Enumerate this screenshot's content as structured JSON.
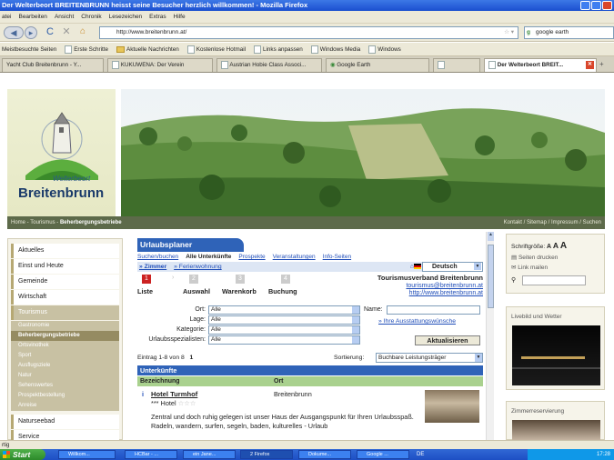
{
  "window": {
    "title": "Der Welterbeort BREITENBRUNN heisst seine Besucher herzlich willkommen! - Mozilla Firefox"
  },
  "menu": [
    "atei",
    "Bearbeiten",
    "Ansicht",
    "Chronik",
    "Lesezeichen",
    "Extras",
    "Hilfe"
  ],
  "nav": {
    "url": "http://www.breitenbrunn.at/",
    "search_value": "google earth"
  },
  "bookmarks": [
    "Meistbesuchte Seiten",
    "Erste Schritte",
    "Aktuelle Nachrichten",
    "Kostenlose Hotmail",
    "Links anpassen",
    "Windows Media",
    "Windows"
  ],
  "tabs": [
    "Yacht Club Breitenbrunn - Y...",
    "KUKUWENA: Der Verein",
    "Austrian Hobie Class Associ...",
    "Google Earth",
    "",
    "Der Welterbeort BREIT..."
  ],
  "site": {
    "logo_small": "Welterbeort",
    "logo_big": "Breitenbrunn",
    "breadcrumb": {
      "home": "Home",
      "sep": " - ",
      "tourismus": "Tourismus",
      "current": "Beherbergungsbetriebe"
    },
    "breadcrumb_right": "Kontakt / Sitemap / Impressum / Suchen"
  },
  "leftnav": {
    "items": [
      "Aktuelles",
      "Einst und Heute",
      "Gemeinde",
      "Wirtschaft"
    ],
    "section": "Tourismus",
    "subitems": [
      "Gastronomie",
      "Beherbergungsbetriebe",
      "Ortsvinothek",
      "Sport",
      "Ausflugsziele",
      "Natur",
      "Sehenswertes",
      "Prospektbestellung",
      "Anreise"
    ],
    "bottom": [
      "Naturseebad",
      "Service"
    ]
  },
  "planer": {
    "title": "Urlaubsplaner",
    "tabs": [
      "Suchen/buchen",
      "Alle Unterkünfte",
      "Prospekte",
      "Veranstaltungen",
      "Info-Seiten"
    ],
    "sub_active": "» Zimmer",
    "sub_other": "» Ferienwohnung",
    "language": "Deutsch",
    "steps": [
      {
        "n": "1",
        "label": "Liste"
      },
      {
        "n": "2",
        "label": "Auswahl"
      },
      {
        "n": "3",
        "label": "Warenkorb"
      },
      {
        "n": "4",
        "label": "Buchung"
      }
    ],
    "org_name": "Tourismusverband Breitenbrunn",
    "org_email": "tourismus@breitenbrunn.at",
    "org_web": "http://www.breitenbrunn.at",
    "form": {
      "ort_label": "Ort:",
      "ort_value": "Alle",
      "lage_label": "Lage:",
      "lage_value": "Alle",
      "kategorie_label": "Kategorie:",
      "kategorie_value": "Alle",
      "spez_label": "Urlaubsspezialisten:",
      "spez_value": "Alle",
      "name_label": "Name:",
      "wishes_link": "» Ihre Ausstattungswünsche",
      "refresh": "Aktualisieren"
    },
    "entries": "Eintrag 1-8 von 8",
    "page": "1",
    "sort_label": "Sortierung:",
    "sort_value": "Buchbare Leistungsträger",
    "list_header": "Unterkünfte",
    "col_name": "Bezeichnung",
    "col_ort": "Ort",
    "hotel": {
      "name": "Hotel Turmhof",
      "ort": "Breitenbrunn",
      "category": "*** Hotel",
      "desc": "Zentral und doch ruhig gelegen ist unser Haus der Ausgangspunkt für Ihren Urlaubsspaß. Radeln, wandern, surfen, segeln, baden, kulturelles - Urlaub"
    }
  },
  "right": {
    "font_label": "Schriftgröße:",
    "font_sizes": [
      "A",
      "A",
      "A"
    ],
    "print": "Seiten drucken",
    "mail": "Link mailen",
    "live_title": "Livebild und Wetter",
    "zimmer_title": "Zimmerreservierung"
  },
  "status": "rtig",
  "taskbar": {
    "start": "Start",
    "items": [
      "Willkom...",
      "HCBar - ...",
      "ein Jane...",
      "2 Firefox",
      "Dokume...",
      "Google ...",
      "DE"
    ],
    "clock": "17:28"
  }
}
